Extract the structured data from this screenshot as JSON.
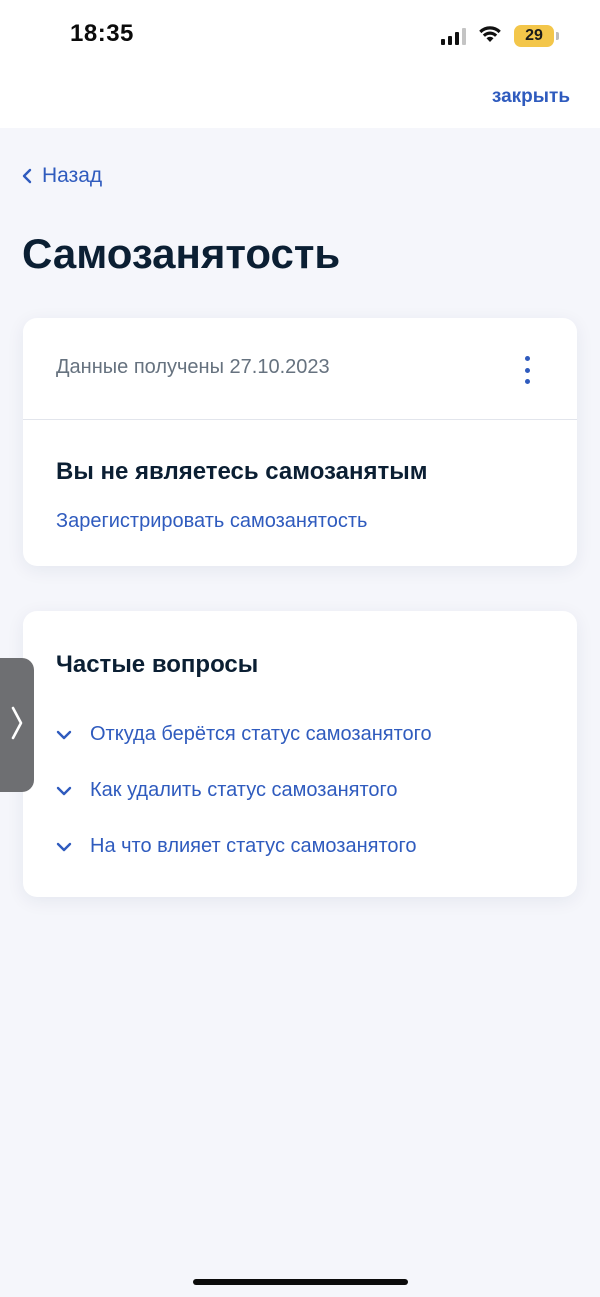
{
  "status_bar": {
    "time": "18:35",
    "battery": "29"
  },
  "header": {
    "close_label": "закрыть"
  },
  "nav": {
    "back_label": "Назад"
  },
  "page": {
    "title": "Самозанятость"
  },
  "status_card": {
    "received_text": "Данные получены 27.10.2023",
    "status_text": "Вы не являетесь самозанятым",
    "register_link": "Зарегистрировать самозанятость"
  },
  "faq": {
    "title": "Частые вопросы",
    "items": [
      {
        "label": "Откуда берётся статус самозанятого"
      },
      {
        "label": "Как удалить статус самозанятого"
      },
      {
        "label": "На что влияет статус самозанятого"
      }
    ]
  },
  "colors": {
    "accent": "#2f5bbe",
    "text": "#0b1f33",
    "muted": "#66727f",
    "background": "#f5f6fb"
  }
}
